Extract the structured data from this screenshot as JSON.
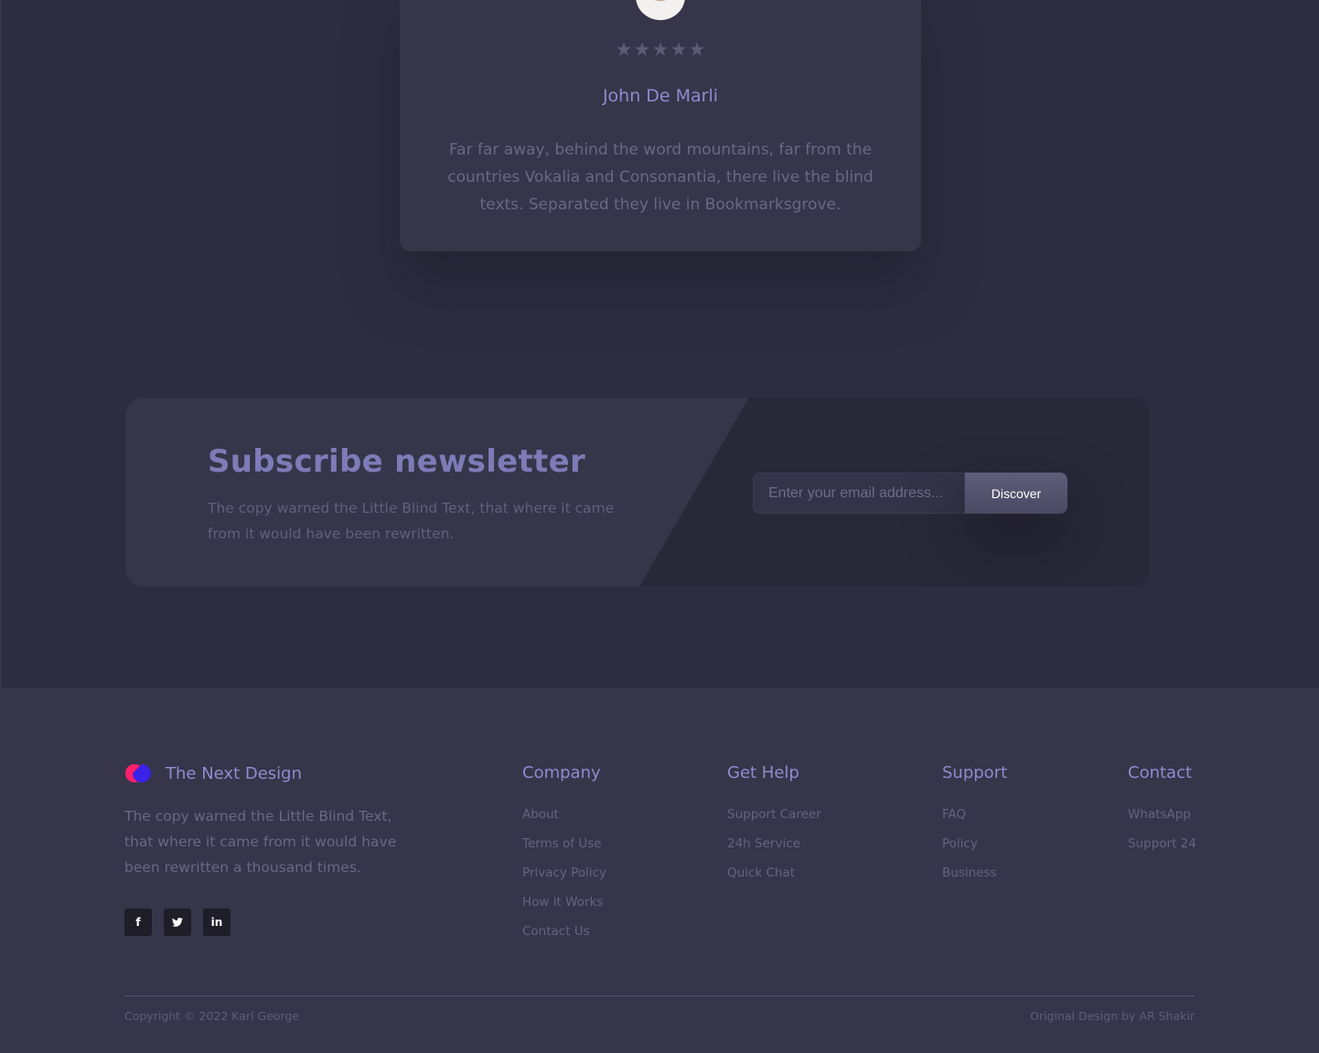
{
  "testimonial": {
    "rating": 5,
    "rating_max": 5,
    "stars": [
      "★",
      "★",
      "★",
      "★",
      "★"
    ],
    "name": "John De Marli",
    "text": "Far far away, behind the word mountains, far from the countries Vokalia and Consonantia, there live the blind texts. Separated they live in Bookmarksgrove."
  },
  "newsletter": {
    "title": "Subscribe newsletter",
    "description": "The copy warned the Little Blind Text, that where it came from it would have been rewritten.",
    "email_placeholder": "Enter your email address...",
    "email_value": "",
    "button_label": "Discover"
  },
  "footer": {
    "brand": {
      "name": "The Next Design",
      "description": "The copy warned the Little Blind Text, that where it came from it would have been rewritten a thousand times.",
      "logo_colors": [
        "#ff1f6b",
        "#3a22e8"
      ]
    },
    "socials": [
      {
        "icon": "facebook-icon",
        "label": "f"
      },
      {
        "icon": "twitter-icon",
        "label": ""
      },
      {
        "icon": "linkedin-icon",
        "label": "in"
      }
    ],
    "columns": [
      {
        "title": "Company",
        "links": [
          "About",
          "Terms of Use",
          "Privacy Policy",
          "How it Works",
          "Contact Us"
        ]
      },
      {
        "title": "Get Help",
        "links": [
          "Support Career",
          "24h Service",
          "Quick Chat"
        ]
      },
      {
        "title": "Support",
        "links": [
          "FAQ",
          "Policy",
          "Business"
        ]
      },
      {
        "title": "Contact",
        "links": [
          "WhatsApp",
          "Support 24"
        ]
      }
    ],
    "copyright": "Copyright © 2022 Karl George",
    "credit": "Original Design by AR Shakir"
  },
  "colors": {
    "background": "#2e2d40",
    "card": "#363549",
    "accent": "#8f8bcf"
  }
}
